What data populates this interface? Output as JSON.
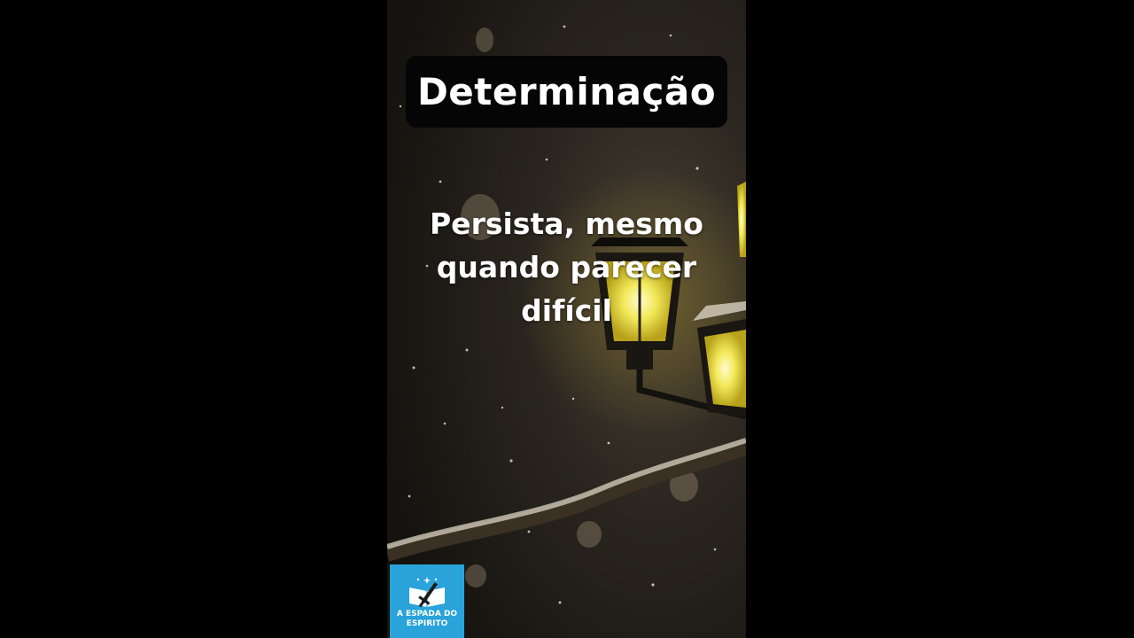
{
  "video": {
    "title": "Determinação",
    "quote_lines": [
      "Persista, mesmo",
      "quando parecer",
      "difícil"
    ]
  },
  "logo": {
    "lines": [
      "A ESPADA DO",
      "ESPIRITO"
    ],
    "background": "#29a3d9",
    "icon": "book-sword-icon"
  },
  "colors": {
    "lamp_glow": "#f4f07a",
    "background_dark": "#1c1915"
  }
}
